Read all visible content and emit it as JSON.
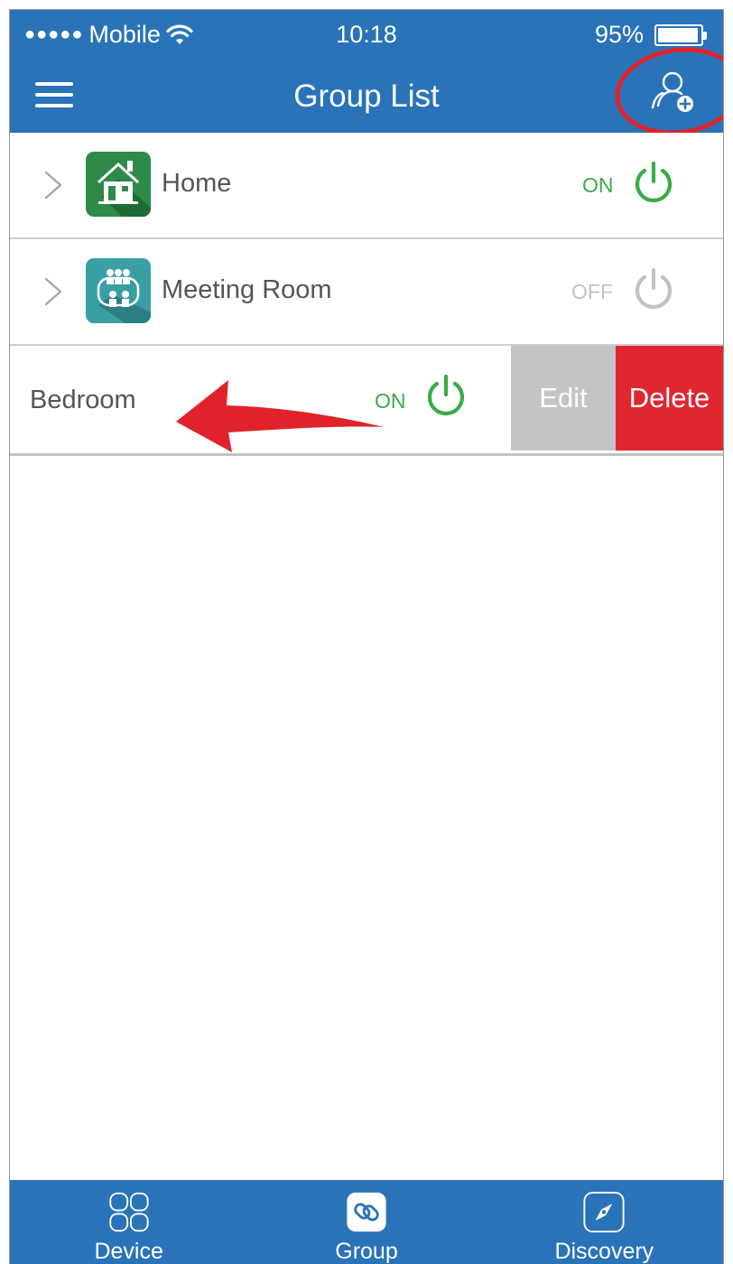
{
  "status_bar": {
    "carrier": "Mobile",
    "time": "10:18",
    "battery": "95%",
    "battery_level": 0.95
  },
  "header": {
    "title": "Group List",
    "menu_icon": "hamburger-menu-icon",
    "add_icon": "add-group-icon"
  },
  "groups": [
    {
      "name": "Home",
      "state": "ON",
      "icon": "house-icon"
    },
    {
      "name": "Meeting Room",
      "state": "OFF",
      "icon": "meeting-people-icon"
    }
  ],
  "swiped_group": {
    "name": "Bedroom",
    "state": "ON",
    "edit_label": "Edit",
    "delete_label": "Delete"
  },
  "tabs": [
    {
      "label": "Device",
      "icon": "device-grid-icon"
    },
    {
      "label": "Group",
      "icon": "group-link-icon",
      "active": true
    },
    {
      "label": "Discovery",
      "icon": "compass-icon"
    }
  ],
  "colors": {
    "primary": "#2a73b8",
    "on": "#3aac47",
    "off": "#c2c2c2",
    "delete": "#e0272f",
    "edit": "#c4c4c6",
    "annotation": "#e0232a"
  }
}
